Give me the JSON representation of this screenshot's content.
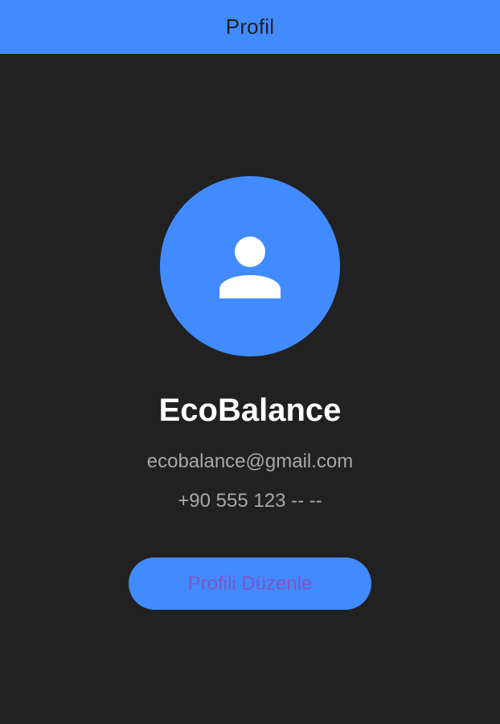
{
  "app_bar": {
    "title": "Profil"
  },
  "profile": {
    "avatar_icon": "person-icon",
    "name": "EcoBalance",
    "email": "ecobalance@gmail.com",
    "phone": "+90 555 123 -- --"
  },
  "actions": {
    "edit_profile_label": "Profili Düzenle"
  },
  "colors": {
    "accent": "#418bff",
    "background": "#212121",
    "name_text": "#ffffff",
    "secondary_text": "#a8a8a8",
    "button_text": "#7e57c2"
  }
}
